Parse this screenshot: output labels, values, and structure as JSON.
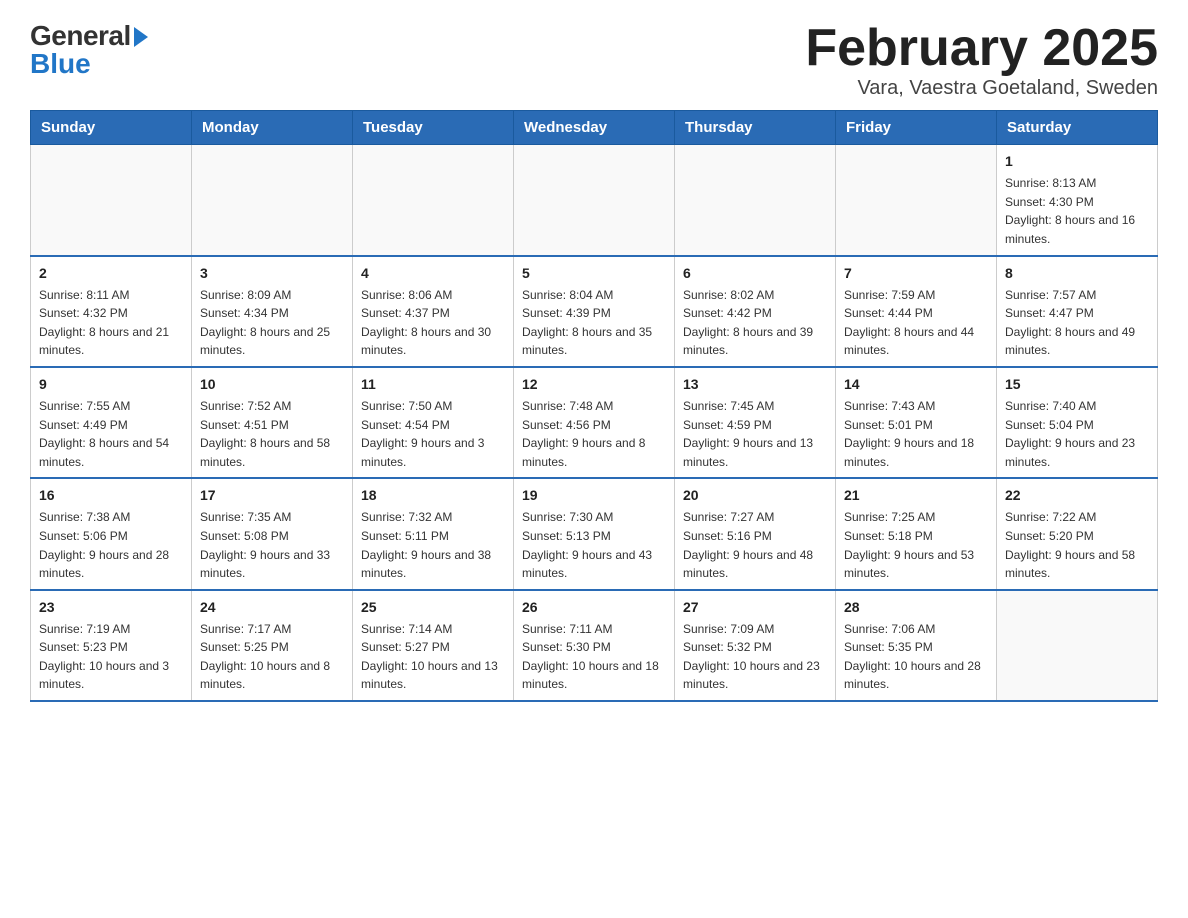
{
  "header": {
    "logo_general": "General",
    "logo_blue": "Blue",
    "title": "February 2025",
    "subtitle": "Vara, Vaestra Goetaland, Sweden"
  },
  "calendar": {
    "days_of_week": [
      "Sunday",
      "Monday",
      "Tuesday",
      "Wednesday",
      "Thursday",
      "Friday",
      "Saturday"
    ],
    "weeks": [
      [
        {
          "day": "",
          "sunrise": "",
          "sunset": "",
          "daylight": ""
        },
        {
          "day": "",
          "sunrise": "",
          "sunset": "",
          "daylight": ""
        },
        {
          "day": "",
          "sunrise": "",
          "sunset": "",
          "daylight": ""
        },
        {
          "day": "",
          "sunrise": "",
          "sunset": "",
          "daylight": ""
        },
        {
          "day": "",
          "sunrise": "",
          "sunset": "",
          "daylight": ""
        },
        {
          "day": "",
          "sunrise": "",
          "sunset": "",
          "daylight": ""
        },
        {
          "day": "1",
          "sunrise": "Sunrise: 8:13 AM",
          "sunset": "Sunset: 4:30 PM",
          "daylight": "Daylight: 8 hours and 16 minutes."
        }
      ],
      [
        {
          "day": "2",
          "sunrise": "Sunrise: 8:11 AM",
          "sunset": "Sunset: 4:32 PM",
          "daylight": "Daylight: 8 hours and 21 minutes."
        },
        {
          "day": "3",
          "sunrise": "Sunrise: 8:09 AM",
          "sunset": "Sunset: 4:34 PM",
          "daylight": "Daylight: 8 hours and 25 minutes."
        },
        {
          "day": "4",
          "sunrise": "Sunrise: 8:06 AM",
          "sunset": "Sunset: 4:37 PM",
          "daylight": "Daylight: 8 hours and 30 minutes."
        },
        {
          "day": "5",
          "sunrise": "Sunrise: 8:04 AM",
          "sunset": "Sunset: 4:39 PM",
          "daylight": "Daylight: 8 hours and 35 minutes."
        },
        {
          "day": "6",
          "sunrise": "Sunrise: 8:02 AM",
          "sunset": "Sunset: 4:42 PM",
          "daylight": "Daylight: 8 hours and 39 minutes."
        },
        {
          "day": "7",
          "sunrise": "Sunrise: 7:59 AM",
          "sunset": "Sunset: 4:44 PM",
          "daylight": "Daylight: 8 hours and 44 minutes."
        },
        {
          "day": "8",
          "sunrise": "Sunrise: 7:57 AM",
          "sunset": "Sunset: 4:47 PM",
          "daylight": "Daylight: 8 hours and 49 minutes."
        }
      ],
      [
        {
          "day": "9",
          "sunrise": "Sunrise: 7:55 AM",
          "sunset": "Sunset: 4:49 PM",
          "daylight": "Daylight: 8 hours and 54 minutes."
        },
        {
          "day": "10",
          "sunrise": "Sunrise: 7:52 AM",
          "sunset": "Sunset: 4:51 PM",
          "daylight": "Daylight: 8 hours and 58 minutes."
        },
        {
          "day": "11",
          "sunrise": "Sunrise: 7:50 AM",
          "sunset": "Sunset: 4:54 PM",
          "daylight": "Daylight: 9 hours and 3 minutes."
        },
        {
          "day": "12",
          "sunrise": "Sunrise: 7:48 AM",
          "sunset": "Sunset: 4:56 PM",
          "daylight": "Daylight: 9 hours and 8 minutes."
        },
        {
          "day": "13",
          "sunrise": "Sunrise: 7:45 AM",
          "sunset": "Sunset: 4:59 PM",
          "daylight": "Daylight: 9 hours and 13 minutes."
        },
        {
          "day": "14",
          "sunrise": "Sunrise: 7:43 AM",
          "sunset": "Sunset: 5:01 PM",
          "daylight": "Daylight: 9 hours and 18 minutes."
        },
        {
          "day": "15",
          "sunrise": "Sunrise: 7:40 AM",
          "sunset": "Sunset: 5:04 PM",
          "daylight": "Daylight: 9 hours and 23 minutes."
        }
      ],
      [
        {
          "day": "16",
          "sunrise": "Sunrise: 7:38 AM",
          "sunset": "Sunset: 5:06 PM",
          "daylight": "Daylight: 9 hours and 28 minutes."
        },
        {
          "day": "17",
          "sunrise": "Sunrise: 7:35 AM",
          "sunset": "Sunset: 5:08 PM",
          "daylight": "Daylight: 9 hours and 33 minutes."
        },
        {
          "day": "18",
          "sunrise": "Sunrise: 7:32 AM",
          "sunset": "Sunset: 5:11 PM",
          "daylight": "Daylight: 9 hours and 38 minutes."
        },
        {
          "day": "19",
          "sunrise": "Sunrise: 7:30 AM",
          "sunset": "Sunset: 5:13 PM",
          "daylight": "Daylight: 9 hours and 43 minutes."
        },
        {
          "day": "20",
          "sunrise": "Sunrise: 7:27 AM",
          "sunset": "Sunset: 5:16 PM",
          "daylight": "Daylight: 9 hours and 48 minutes."
        },
        {
          "day": "21",
          "sunrise": "Sunrise: 7:25 AM",
          "sunset": "Sunset: 5:18 PM",
          "daylight": "Daylight: 9 hours and 53 minutes."
        },
        {
          "day": "22",
          "sunrise": "Sunrise: 7:22 AM",
          "sunset": "Sunset: 5:20 PM",
          "daylight": "Daylight: 9 hours and 58 minutes."
        }
      ],
      [
        {
          "day": "23",
          "sunrise": "Sunrise: 7:19 AM",
          "sunset": "Sunset: 5:23 PM",
          "daylight": "Daylight: 10 hours and 3 minutes."
        },
        {
          "day": "24",
          "sunrise": "Sunrise: 7:17 AM",
          "sunset": "Sunset: 5:25 PM",
          "daylight": "Daylight: 10 hours and 8 minutes."
        },
        {
          "day": "25",
          "sunrise": "Sunrise: 7:14 AM",
          "sunset": "Sunset: 5:27 PM",
          "daylight": "Daylight: 10 hours and 13 minutes."
        },
        {
          "day": "26",
          "sunrise": "Sunrise: 7:11 AM",
          "sunset": "Sunset: 5:30 PM",
          "daylight": "Daylight: 10 hours and 18 minutes."
        },
        {
          "day": "27",
          "sunrise": "Sunrise: 7:09 AM",
          "sunset": "Sunset: 5:32 PM",
          "daylight": "Daylight: 10 hours and 23 minutes."
        },
        {
          "day": "28",
          "sunrise": "Sunrise: 7:06 AM",
          "sunset": "Sunset: 5:35 PM",
          "daylight": "Daylight: 10 hours and 28 minutes."
        },
        {
          "day": "",
          "sunrise": "",
          "sunset": "",
          "daylight": ""
        }
      ]
    ]
  }
}
